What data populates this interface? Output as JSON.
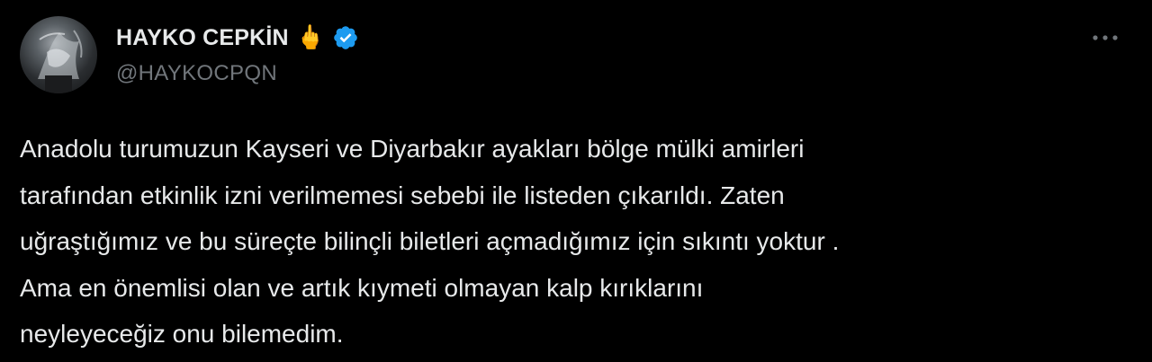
{
  "author": {
    "display_name": "HAYKO CEPKİN",
    "emoji": "🖕",
    "handle": "@HAYKOCPQN",
    "verified": true,
    "verified_color": "#1d9bf0"
  },
  "actions": {
    "more_icon": "more-horizontal-icon"
  },
  "tweet": {
    "lines": [
      "Anadolu turumuzun Kayseri ve Diyarbakır ayakları bölge mülki amirleri",
      "tarafından etkinlik izni verilmemesi sebebi ile listeden çıkarıldı. Zaten",
      "uğraştığımız ve bu süreçte bilinçli biletleri açmadığımız için sıkıntı yoktur .",
      "Ama en önemlisi olan ve artık kıymeti olmayan kalp kırıklarını",
      "neyleyeceğiz onu bilemedim."
    ]
  },
  "colors": {
    "background": "#000000",
    "text_primary": "#e7e9ea",
    "text_secondary": "#71767b",
    "accent": "#1d9bf0"
  }
}
